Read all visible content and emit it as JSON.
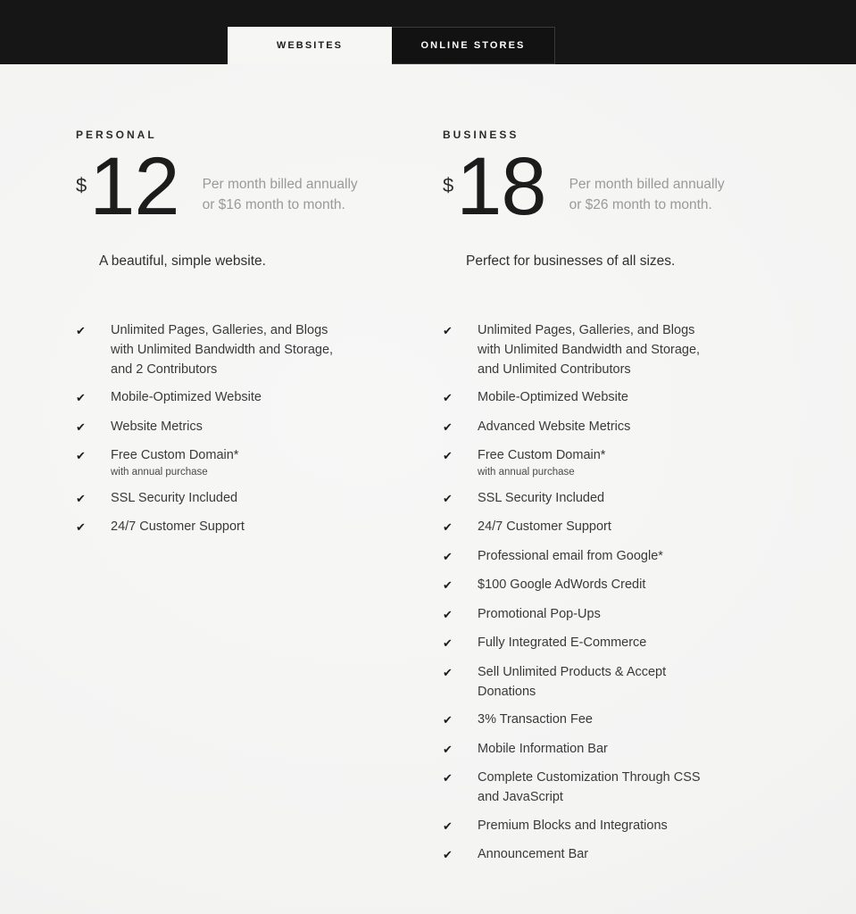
{
  "tabs": [
    {
      "label": "WEBSITES",
      "active": true
    },
    {
      "label": "ONLINE STORES",
      "active": false
    }
  ],
  "colors": {
    "page_background": "#f4f4f3",
    "topbar": "#161616",
    "active_tab_bg": "#f6f6f5",
    "inactive_tab_bg": "#121212",
    "price_text": "#1c1c1c",
    "billing_text": "#9a9a9a",
    "feature_text": "#3a3a3a"
  },
  "plans": [
    {
      "name": "PERSONAL",
      "currency": "$",
      "price": "12",
      "billing": "Per month billed annually or $16 month to month.",
      "tagline": "A beautiful, simple website.",
      "features": [
        {
          "text": "Unlimited Pages, Galleries, and Blogs with Unlimited Bandwidth and Storage, and 2 Contributors",
          "note": ""
        },
        {
          "text": "Mobile-Optimized Website",
          "note": ""
        },
        {
          "text": "Website Metrics",
          "note": ""
        },
        {
          "text": "Free Custom Domain*",
          "note": "with annual purchase"
        },
        {
          "text": "SSL Security Included",
          "note": ""
        },
        {
          "text": "24/7 Customer Support",
          "note": ""
        }
      ]
    },
    {
      "name": "BUSINESS",
      "currency": "$",
      "price": "18",
      "billing": "Per month billed annually or $26 month to month.",
      "tagline": "Perfect for businesses of all sizes.",
      "features": [
        {
          "text": "Unlimited Pages, Galleries, and Blogs with Unlimited Bandwidth and Storage, and Unlimited Contributors",
          "note": ""
        },
        {
          "text": "Mobile-Optimized Website",
          "note": ""
        },
        {
          "text": "Advanced Website Metrics",
          "note": ""
        },
        {
          "text": "Free Custom Domain*",
          "note": "with annual purchase"
        },
        {
          "text": "SSL Security Included",
          "note": ""
        },
        {
          "text": "24/7 Customer Support",
          "note": ""
        },
        {
          "text": "Professional email from Google*",
          "note": ""
        },
        {
          "text": "$100 Google AdWords Credit",
          "note": ""
        },
        {
          "text": "Promotional Pop-Ups",
          "note": ""
        },
        {
          "text": "Fully Integrated E-Commerce",
          "note": ""
        },
        {
          "text": "Sell Unlimited Products & Accept Donations",
          "note": ""
        },
        {
          "text": "3% Transaction Fee",
          "note": ""
        },
        {
          "text": "Mobile Information Bar",
          "note": ""
        },
        {
          "text": "Complete Customization Through CSS and JavaScript",
          "note": ""
        },
        {
          "text": "Premium Blocks and Integrations",
          "note": ""
        },
        {
          "text": "Announcement Bar",
          "note": ""
        }
      ]
    }
  ],
  "icons": {
    "check": "✔"
  }
}
